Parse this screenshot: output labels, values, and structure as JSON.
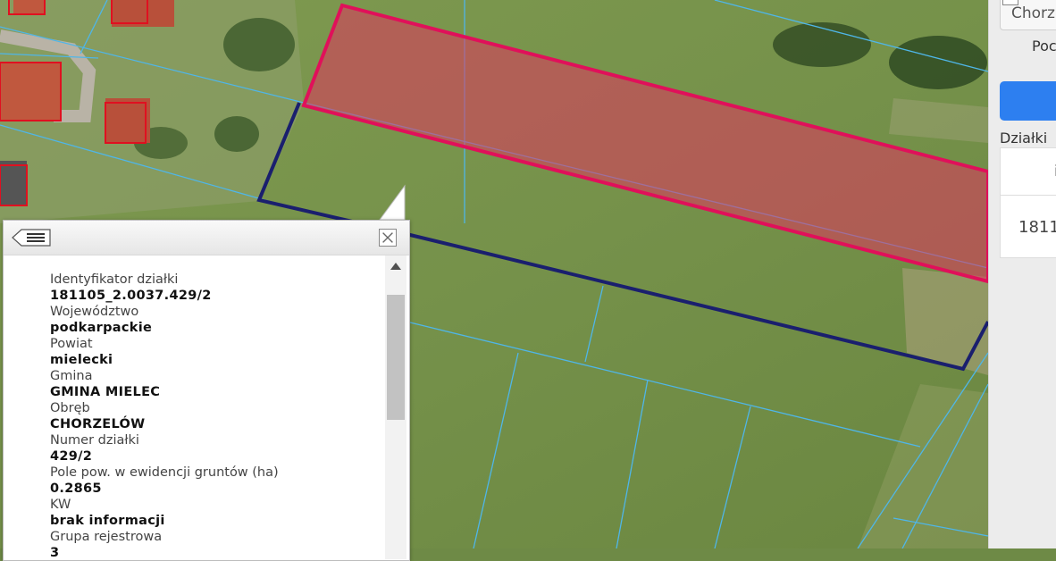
{
  "parcel_info": {
    "rows": [
      {
        "label": "Identyfikator działki",
        "value": "181105_2.0037.429/2"
      },
      {
        "label": "Województwo",
        "value": "podkarpackie"
      },
      {
        "label": "Powiat",
        "value": "mielecki"
      },
      {
        "label": "Gmina",
        "value": "GMINA MIELEC"
      },
      {
        "label": "Obręb",
        "value": "CHORZELÓW"
      },
      {
        "label": "Numer działki",
        "value": "429/2"
      },
      {
        "label": "Pole pow. w ewidencji gruntów (ha)",
        "value": "0.2865"
      },
      {
        "label": "KW",
        "value": "brak informacji"
      },
      {
        "label": "Grupa rejestrowa",
        "value": "3"
      }
    ]
  },
  "side_panel": {
    "search_text": "Chorz",
    "label": "Poc",
    "parcels_heading": "Działki",
    "table_col": "i",
    "table_value": "1811"
  },
  "icons": {
    "back": "back-list-icon",
    "close": "close-icon",
    "scroll_up": "scroll-up-icon"
  },
  "colors": {
    "selected_parcel_fill": "#e0345f",
    "selected_parcel_stroke": "#e0105a",
    "parcel_outline": "#1a1f6e",
    "parcel_boundaries": "#4fb6e8",
    "building_outline": "#e01020"
  }
}
